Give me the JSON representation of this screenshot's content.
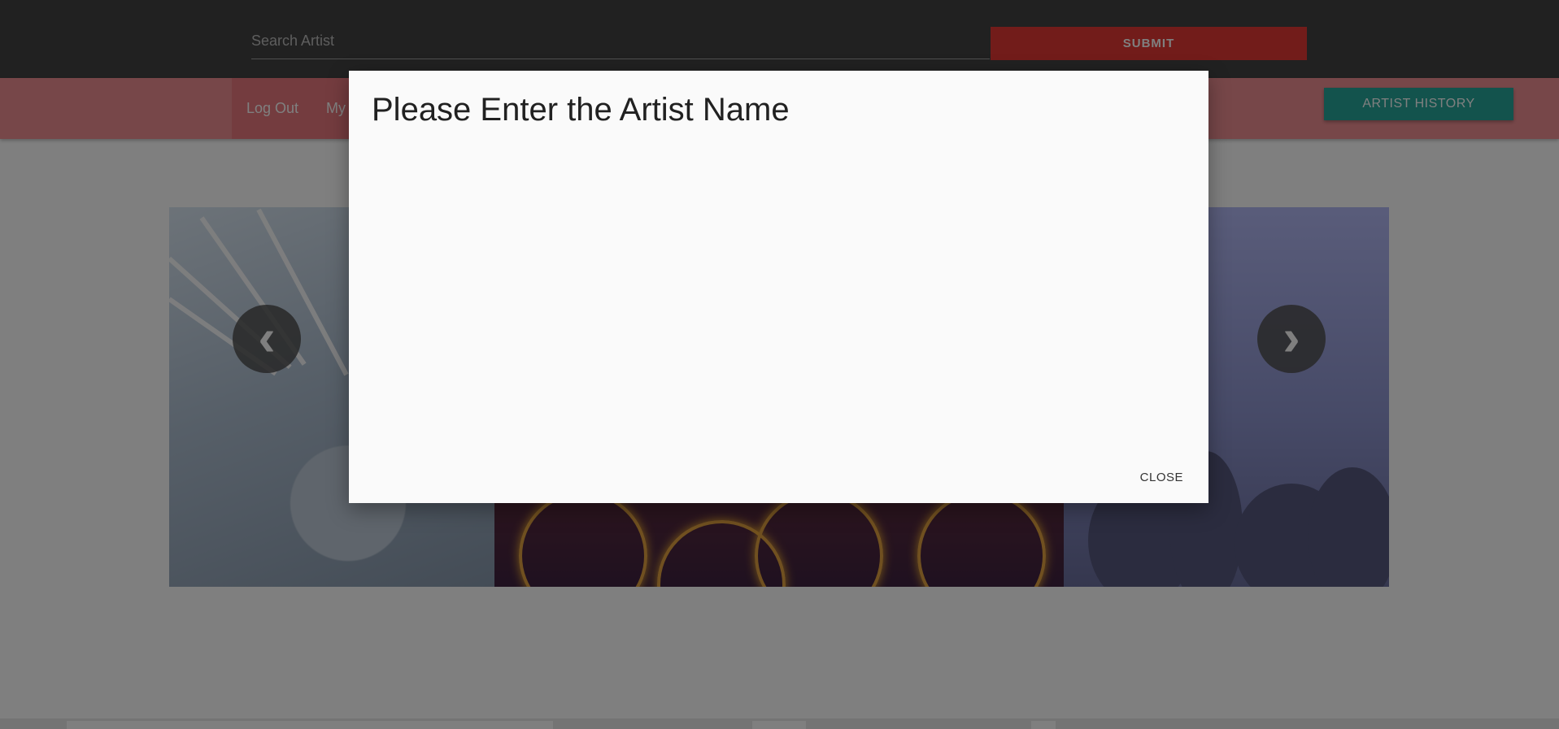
{
  "search": {
    "placeholder": "Search Artist",
    "submit_label": "SUBMIT"
  },
  "nav": {
    "links": [
      "Log Out",
      "My"
    ],
    "artist_history_label": "ARTIST HISTORY"
  },
  "carousel": {
    "prev_icon": "chevron-left-icon",
    "next_icon": "chevron-right-icon",
    "prev_glyph": "‹",
    "next_glyph": "›"
  },
  "modal": {
    "title": "Please Enter the Artist Name",
    "close_label": "CLOSE"
  },
  "colors": {
    "topbar": "#424242",
    "submit": "#e53935",
    "navbar": "#ef8f93",
    "artist_history": "#26a69a",
    "overlay": "rgba(0,0,0,0.5)",
    "modal_bg": "#fafafa"
  }
}
